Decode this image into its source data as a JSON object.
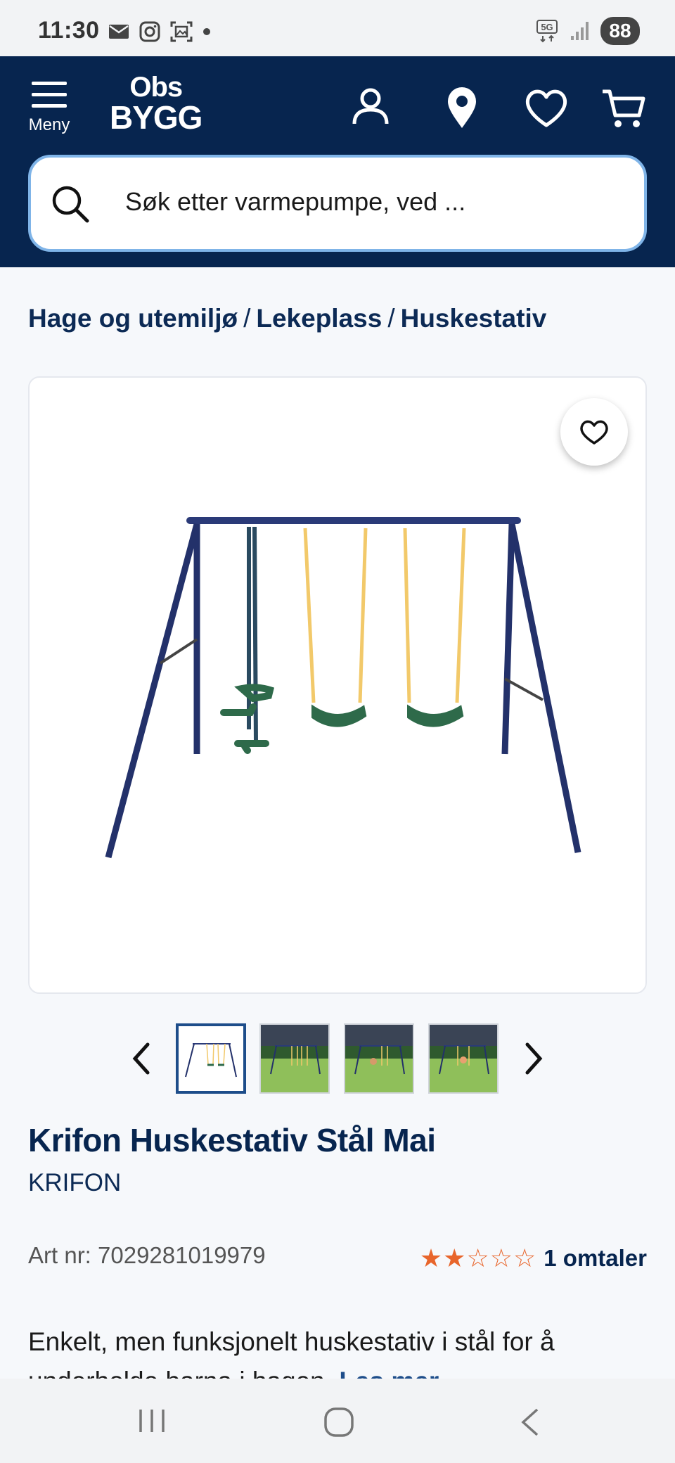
{
  "status_bar": {
    "time": "11:30",
    "network": "5G",
    "battery": "88"
  },
  "header": {
    "menu_label": "Meny",
    "logo_line1": "Obs",
    "logo_line2": "BYGG",
    "search_placeholder": "Søk etter varmepumpe, ved ..."
  },
  "breadcrumb": {
    "items": [
      "Hage og utemiljø",
      "Lekeplass",
      "Huskestativ"
    ],
    "separator": "/"
  },
  "product": {
    "title": "Krifon Huskestativ Stål Mai",
    "brand": "KRIFON",
    "art_nr": "Art nr: 7029281019979",
    "rating_value": 2,
    "rating_max": 5,
    "rating_stars": "★★☆☆☆",
    "reviews": "1 omtaler",
    "description": "Enkelt, men funksjonelt huskestativ i stål for å underholde barna i hagen.",
    "read_more": "Les mer"
  },
  "gallery": {
    "image_count": 4,
    "active_index": 0
  },
  "colors": {
    "header_bg": "#07254f",
    "accent": "#1d4d8a",
    "star": "#e8652b",
    "search_border": "#7fb4e8"
  }
}
